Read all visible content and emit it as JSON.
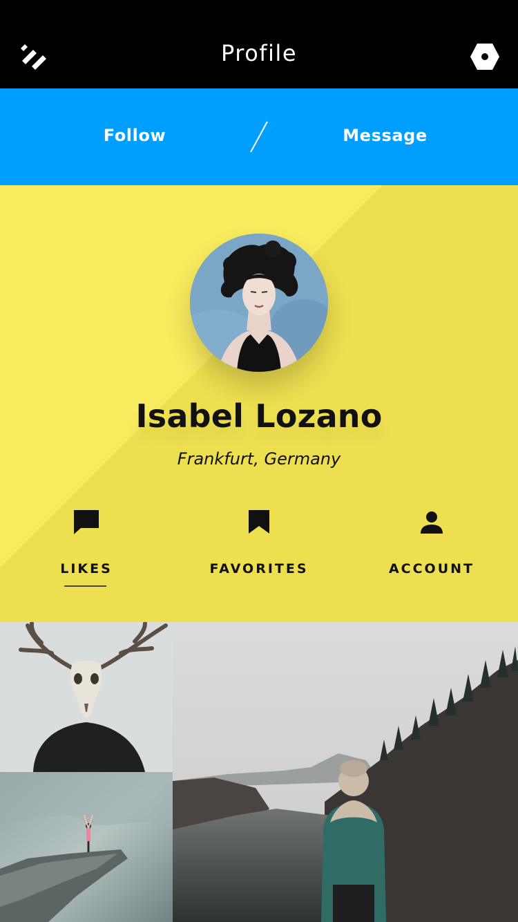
{
  "header": {
    "title": "Profile",
    "menu_icon": "double-slash-menu-icon",
    "settings_icon": "hexagon-settings-icon"
  },
  "actions": {
    "follow_label": "Follow",
    "message_label": "Message"
  },
  "profile": {
    "name": "Isabel Lozano",
    "location": "Frankfurt, Germany"
  },
  "tabs": [
    {
      "label": "LIKES",
      "icon": "comment-icon",
      "selected": true
    },
    {
      "label": "FAVORITES",
      "icon": "bookmark-icon",
      "selected": false
    },
    {
      "label": "ACCOUNT",
      "icon": "person-icon",
      "selected": false
    }
  ],
  "colors": {
    "topbar": "#000000",
    "accent_blue": "#009FFF",
    "panel_yellow_light": "#F9EB5E",
    "panel_yellow_dark": "#EDDF50",
    "text_dark": "#111111"
  },
  "photos": [
    {
      "subject": "deer-skull-portrait"
    },
    {
      "subject": "person-on-cliff"
    },
    {
      "subject": "hiker-by-lake"
    }
  ]
}
